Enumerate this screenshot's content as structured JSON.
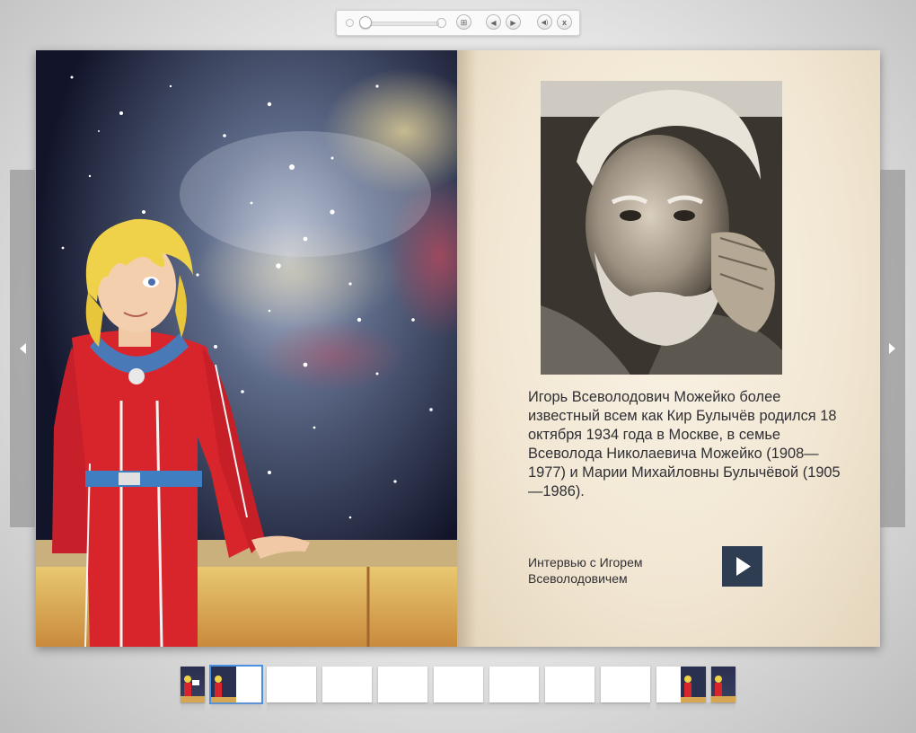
{
  "toolbar": {
    "icons": [
      "zoom-out-icon",
      "zoom-slider",
      "zoom-in-icon",
      "grid-icon",
      "previous-icon",
      "next-icon",
      "sound-icon",
      "close-icon"
    ],
    "zoom_level": 0,
    "grid_glyph": "⊞",
    "prev_glyph": "◀",
    "next_glyph": "▶",
    "sound_glyph": "◀)",
    "close_glyph": "x"
  },
  "book": {
    "left_page": {
      "illustration": "girl-in-red-spacesuit-starry-sky"
    },
    "right_page": {
      "portrait": "photo-of-igor-mozheyko",
      "bio_text": "Игорь Всеволодович Можейко более известный всем как Кир Булычёв родился 18 октября 1934 года в Москве, в семье Всеволода Николаевича Можейко (1908—1977)  и Марии Михайловны Булычёвой (1905—1986).",
      "interview_label": "Интервью с Игорем Всеволодовичем",
      "play_glyph": "▶"
    }
  },
  "side_nav": {
    "prev_glyph": "◀",
    "next_glyph": "▶"
  },
  "thumbnails": {
    "count": 11,
    "selected_index": 1
  },
  "colors": {
    "play_button": "#2e3d52",
    "suit_red": "#d8252c",
    "hair_yellow": "#efd24a",
    "page_paper": "#f1e6d2"
  }
}
